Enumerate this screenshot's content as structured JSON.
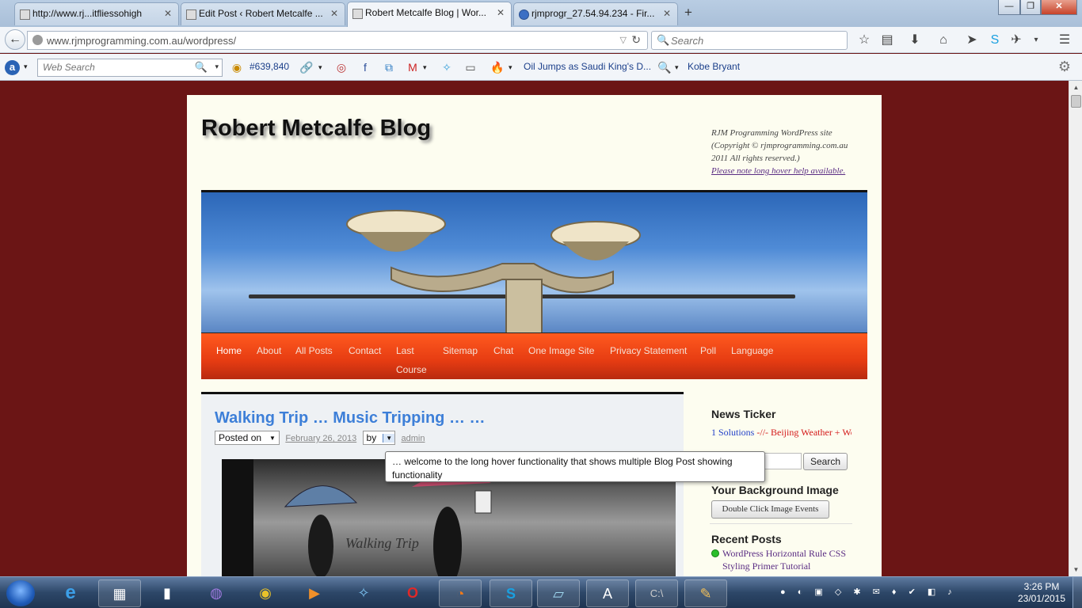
{
  "browser": {
    "tabs": [
      {
        "title": "http://www.rj...itflies​sohigh",
        "active": false
      },
      {
        "title": "Edit Post ‹ Robert Metcalfe ...",
        "active": false
      },
      {
        "title": "Robert Metcalfe Blog | Wor...",
        "active": true
      },
      {
        "title": "rjmprogr_27.54.94.234 - Fir...",
        "active": false
      }
    ],
    "window_controls": {
      "minimize": "—",
      "maximize": "❐",
      "close": "✕"
    },
    "url_prefix": "www.rjmprogramming.com.au",
    "url_path": "/wordpress/",
    "search_placeholder": "Search"
  },
  "toolbar": {
    "web_search_placeholder": "Web Search",
    "rank": "#639,840",
    "news_headline": "Oil Jumps as Saudi King's D...",
    "trending": "Kobe Bryant"
  },
  "site": {
    "title": "Robert Metcalfe Blog",
    "desc_lines": [
      "RJM Programming WordPress site",
      "(Copyright © rjmprogramming.com.au",
      "2011 All rights reserved.)"
    ],
    "help_link": "Please note long hover help available.",
    "nav": [
      "Home",
      "About",
      "All Posts",
      "Contact",
      "Last",
      "Sitemap",
      "Chat",
      "One Image Site",
      "Privacy Statement",
      "Poll",
      "Language"
    ],
    "nav_last_line2": "Course"
  },
  "post": {
    "title": "Walking Trip … Music Tripping … …",
    "posted_on": "Posted on",
    "date": "February 26, 2013",
    "by": "by",
    "author": "admin",
    "image_caption": "Walking Trip"
  },
  "tooltip": {
    "text": "… welcome to the long hover functionality that shows multiple Blog Post showing functionality"
  },
  "sidebar": {
    "news_ticker_title": "News Ticker",
    "ticker_blue": "1 Solutions",
    "ticker_red": " -//- Beijing Weather + Wo",
    "search_button": "Search",
    "bg_title": "Your Background Image",
    "bg_button": "Double Click Image Events",
    "recent_title": "Recent Posts",
    "recent_item": "WordPress Horizontal Rule CSS Styling Primer Tutorial"
  },
  "taskbar": {
    "time": "3:26 PM",
    "date": "23/01/2015"
  },
  "colors": {
    "page_bg": "#6b1515",
    "nav_orange": "#e63c12",
    "post_title_blue": "#3d7fd8",
    "ticker_red": "#d41a1a"
  }
}
